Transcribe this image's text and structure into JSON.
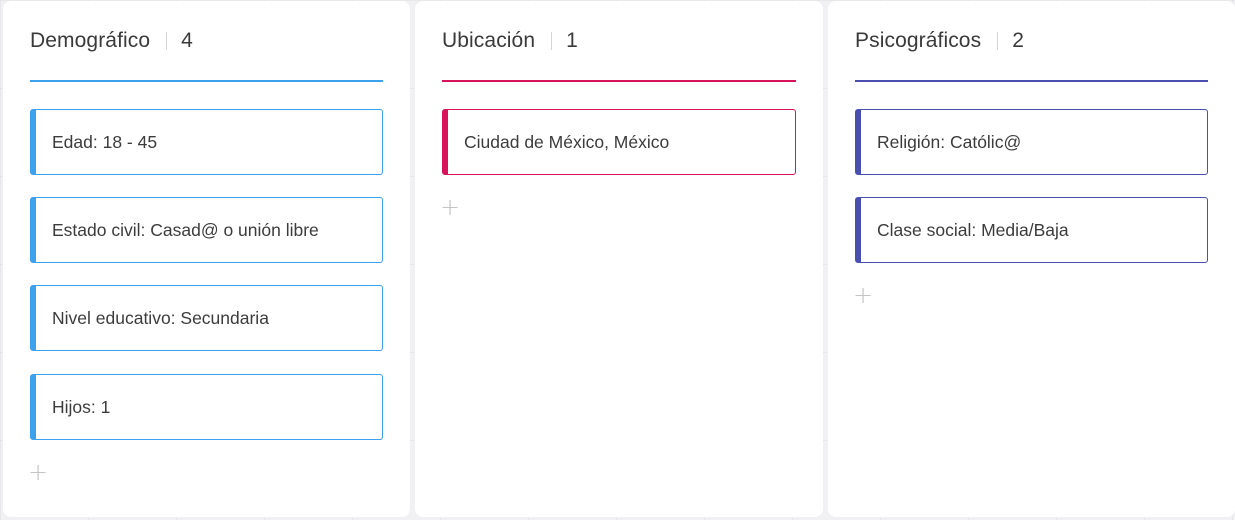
{
  "columns": [
    {
      "title": "Demográfico",
      "count": "4",
      "color": "#3ea1ee",
      "cards": [
        "Edad: 18 - 45",
        "Estado civil: Casad@ o unión libre",
        "Nivel educativo: Secundaria",
        "Hijos: 1"
      ],
      "add_icon": "+"
    },
    {
      "title": "Ubicación",
      "count": "1",
      "color": "#d8125b",
      "cards": [
        "Ciudad de México, México"
      ],
      "add_icon": "+"
    },
    {
      "title": "Psicográficos",
      "count": "2",
      "color": "#4a50b0",
      "cards": [
        "Religión: Católic@",
        "Clase social: Media/Baja"
      ],
      "add_icon": "+"
    }
  ]
}
